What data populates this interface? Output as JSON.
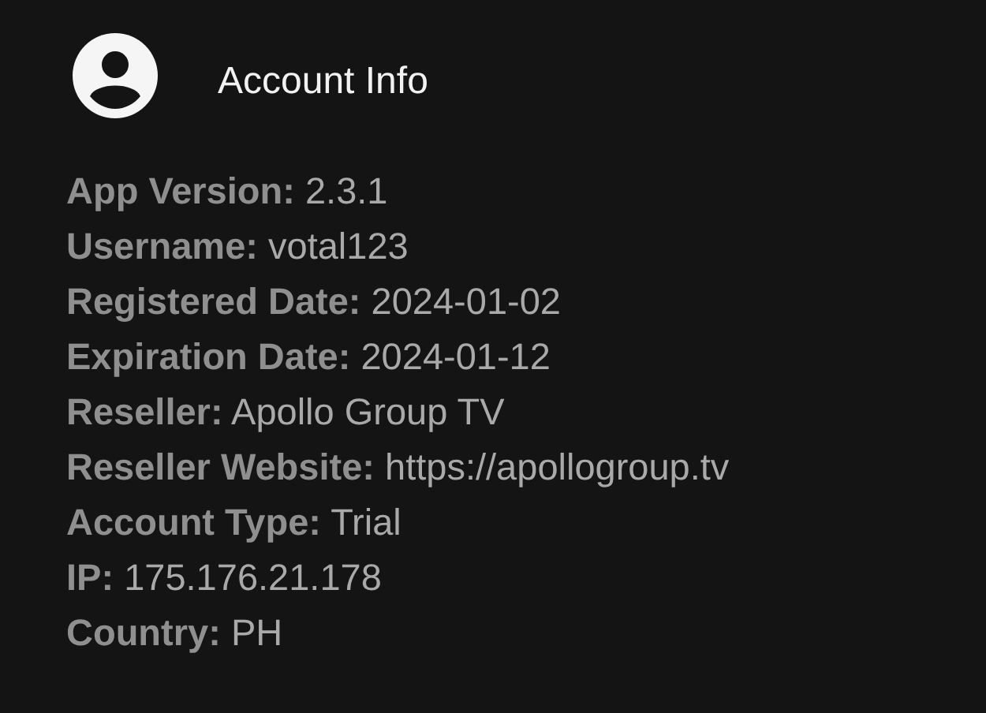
{
  "header": {
    "title": "Account Info"
  },
  "fields": [
    {
      "label": "App Version:",
      "value": "2.3.1"
    },
    {
      "label": "Username:",
      "value": "votal123"
    },
    {
      "label": "Registered Date:",
      "value": "2024-01-02"
    },
    {
      "label": "Expiration Date:",
      "value": "2024-01-12"
    },
    {
      "label": "Reseller:",
      "value": "Apollo Group TV"
    },
    {
      "label": "Reseller Website:",
      "value": "https://apollogroup.tv"
    },
    {
      "label": "Account Type:",
      "value": "Trial"
    },
    {
      "label": "IP:",
      "value": "175.176.21.178"
    },
    {
      "label": "Country:",
      "value": "PH"
    }
  ]
}
